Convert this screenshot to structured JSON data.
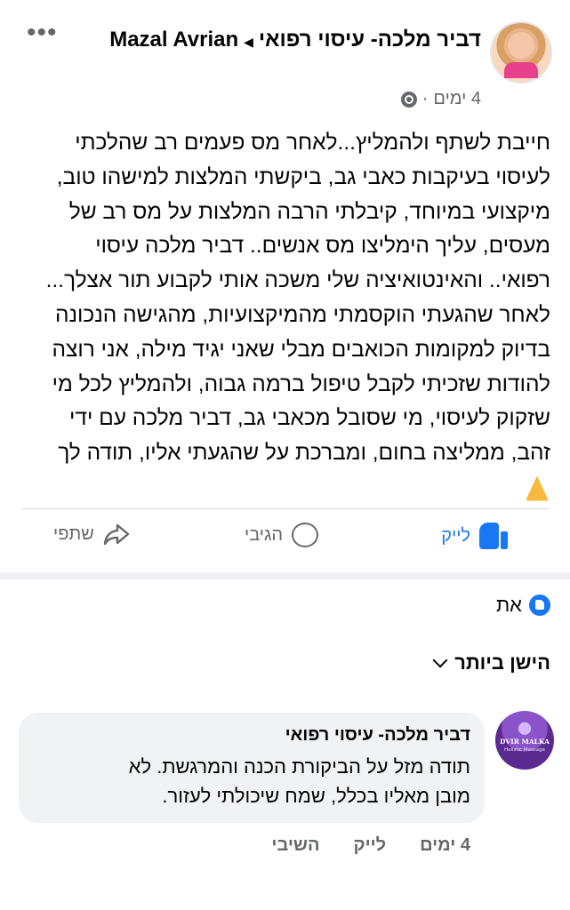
{
  "post": {
    "author_line_part1": "דביר מלכה- עיסוי רפואי",
    "author_line_part2": "Mazal Avrian",
    "time": "4 ימים",
    "body": "חייבת לשתף ולהמליץ...לאחר מס פעמים רב שהלכתי\nלעיסוי בעיקבות כאבי גב, ביקשתי המלצות למישהו טוב,\nמיקצועי במיוחד, קיבלתי הרבה המלצות על מס רב של\nמעסים, עליך הימליצו מס אנשים.. דביר מלכה עיסוי\nרפואי.. והאינטואיציה שלי משכה אותי לקבוע תור אצלך...\nלאחר שהגעתי הוקסמתי מהמיקצועיות, מהגישה הנכונה\nבדיוק למקומות הכואבים מבלי שאני יגיד מילה, אני רוצה\nלהודות שזכיתי לקבל טיפול ברמה גבוה, ולהמליץ לכל מי\nשזקוק לעיסוי, מי שסובל מכאבי גב, דביר מלכה עם ידי\nזהב,  ממליצה בחום, ומברכת על שהגעתי אליו, תודה לך",
    "body_emoji": "folded-hands-emoji"
  },
  "actions": {
    "like": "לייק",
    "comment": "הגיבי",
    "share": "שתפי"
  },
  "reactions": {
    "label": "את"
  },
  "sort": {
    "label": "הישן ביותר"
  },
  "comment": {
    "avatar_brand": "DVIR MALKA",
    "avatar_sub": "Holistic Massage",
    "author": "דביר מלכה- עיסוי רפואי",
    "text": "תודה מזל על הביקורת הכנה והמרגשת. לא\nמובן מאליו בכלל, שמח שיכולתי לעזור.",
    "time": "4 ימים",
    "like": "לייק",
    "reply": "השיבי"
  },
  "colors": {
    "accent": "#1877f2",
    "secondary_text": "#65676b",
    "bubble": "#f0f2f5"
  }
}
